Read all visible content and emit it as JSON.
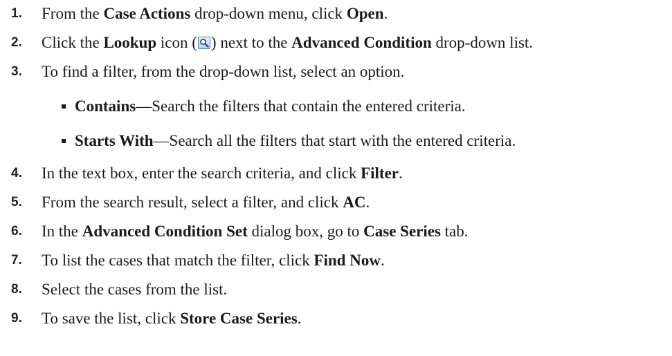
{
  "steps": [
    {
      "number": "1.",
      "parts": [
        "From the ",
        "Case Actions",
        " drop-down menu, click ",
        "Open",
        "."
      ]
    },
    {
      "number": "2.",
      "parts": [
        "Click the ",
        "Lookup",
        " icon (",
        ") next to the ",
        "Advanced Condition",
        " drop-down list."
      ]
    },
    {
      "number": "3.",
      "parts": [
        "To find a filter, from the drop-down list, select an option."
      ]
    },
    {
      "number": "4.",
      "parts": [
        "In the text box, enter the search criteria, and click ",
        "Filter",
        "."
      ]
    },
    {
      "number": "5.",
      "parts": [
        "From the search result, select a filter, and click ",
        "AC",
        "."
      ]
    },
    {
      "number": "6.",
      "parts": [
        "In the ",
        "Advanced Condition Set",
        " dialog box, go to ",
        "Case Series",
        " tab."
      ]
    },
    {
      "number": "7.",
      "parts": [
        "To list the cases that match the filter, click ",
        "Find Now",
        "."
      ]
    },
    {
      "number": "8.",
      "parts": [
        "Select the cases from the list."
      ]
    },
    {
      "number": "9.",
      "parts": [
        "To save the list, click ",
        "Store Case Series",
        "."
      ]
    }
  ],
  "options": [
    {
      "term": "Contains",
      "description": "—Search the filters that contain the entered criteria."
    },
    {
      "term": "Starts With",
      "description": "—Search all the filters that start with the entered criteria."
    }
  ],
  "icons": {
    "lookup": "magnifier-lookup-icon",
    "bullet": "square-bullet"
  }
}
